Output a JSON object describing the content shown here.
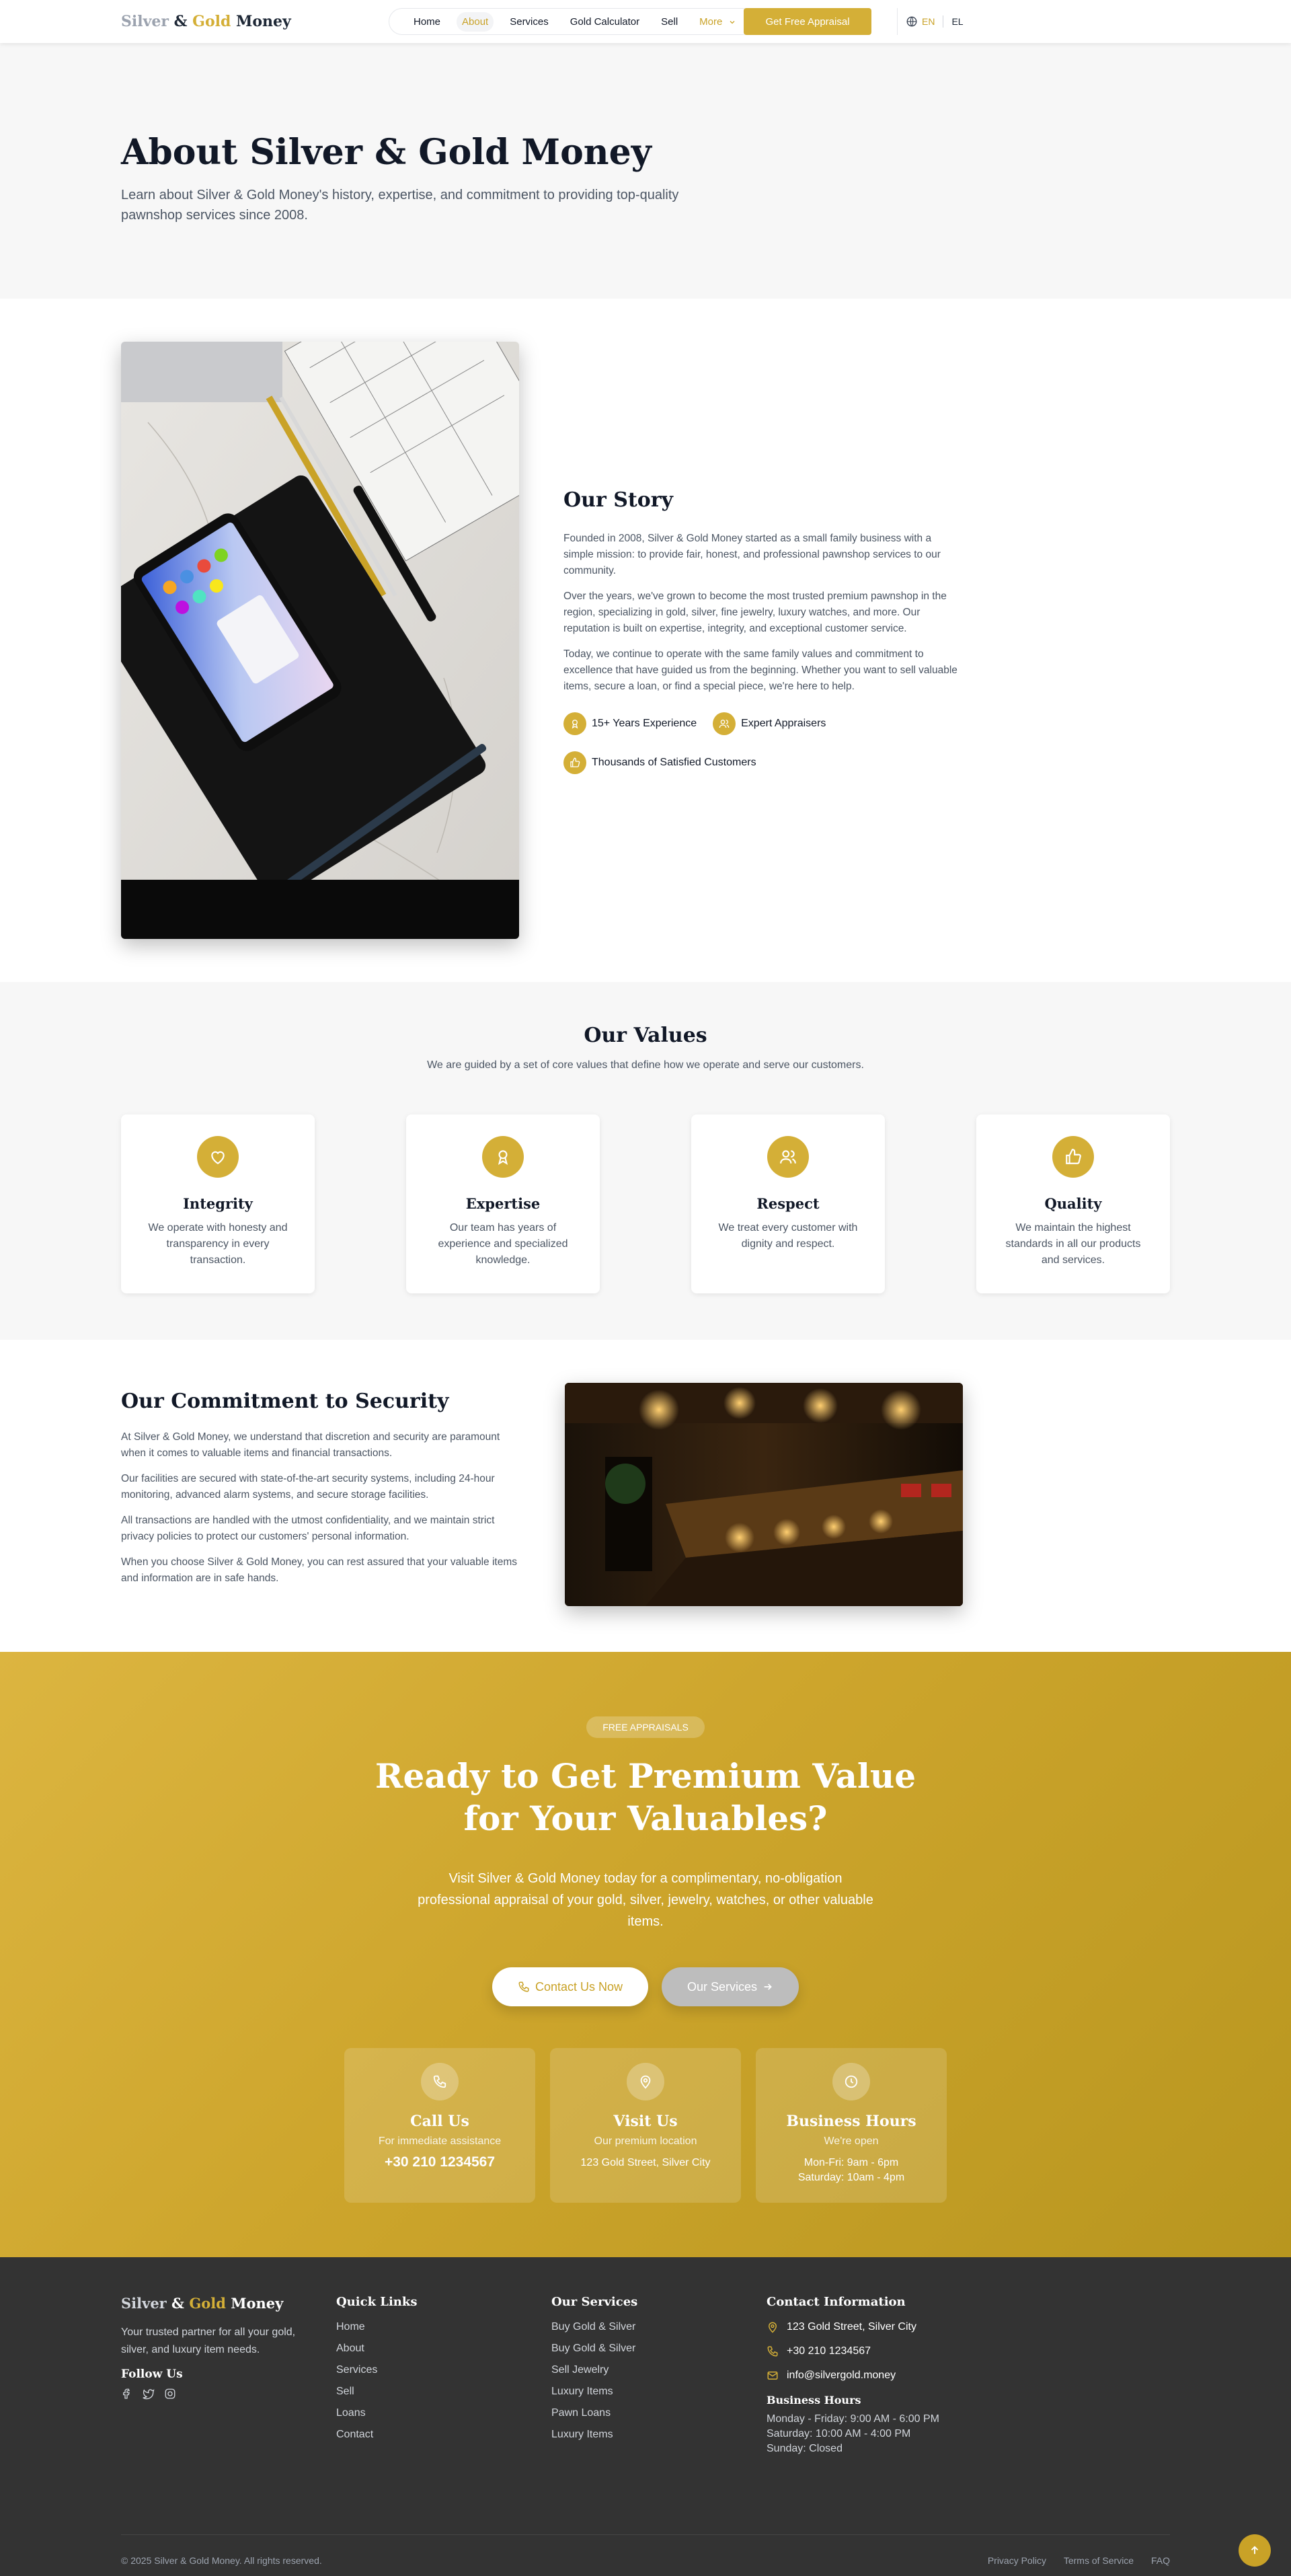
{
  "header": {
    "logo": {
      "part1": "Silver",
      "part2": " & ",
      "part3": "Gold",
      "part4": " Money"
    },
    "nav": [
      "Home",
      "About",
      "Services",
      "Gold Calculator",
      "Sell",
      "More"
    ],
    "cta": "Get Free Appraisal",
    "lang": {
      "current": "EN",
      "other": "EL"
    }
  },
  "hero": {
    "title": "About Silver & Gold Money",
    "subtitle": "Learn about Silver & Gold Money's history, expertise, and commitment to providing top-quality pawnshop services since 2008."
  },
  "story": {
    "title": "Our Story",
    "paragraphs": [
      "Founded in 2008, Silver & Gold Money started as a small family business with a simple mission: to provide fair, honest, and professional pawnshop services to our community.",
      "Over the years, we've grown to become the most trusted premium pawnshop in the region, specializing in gold, silver, fine jewelry, luxury watches, and more. Our reputation is built on expertise, integrity, and exceptional customer service.",
      "Today, we continue to operate with the same family values and commitment to excellence that have guided us from the beginning. Whether you want to sell valuable items, secure a loan, or find a special piece, we're here to help."
    ],
    "features": [
      "15+ Years Experience",
      "Expert Appraisers",
      "Thousands of Satisfied Customers"
    ]
  },
  "values": {
    "title": "Our Values",
    "subtitle": "We are guided by a set of core values that define how we operate and serve our customers.",
    "cards": [
      {
        "title": "Integrity",
        "text": "We operate with honesty and transparency in every transaction.",
        "icon": "heart-icon"
      },
      {
        "title": "Expertise",
        "text": "Our team has years of experience and specialized knowledge.",
        "icon": "award-icon"
      },
      {
        "title": "Respect",
        "text": "We treat every customer with dignity and respect.",
        "icon": "users-icon"
      },
      {
        "title": "Quality",
        "text": "We maintain the highest standards in all our products and services.",
        "icon": "thumbs-up-icon"
      }
    ]
  },
  "security": {
    "title": "Our Commitment to Security",
    "paragraphs": [
      "At Silver & Gold Money, we understand that discretion and security are paramount when it comes to valuable items and financial transactions.",
      "Our facilities are secured with state-of-the-art security systems, including 24-hour monitoring, advanced alarm systems, and secure storage facilities.",
      "All transactions are handled with the utmost confidentiality, and we maintain strict privacy policies to protect our customers' personal information.",
      "When you choose Silver & Gold Money, you can rest assured that your valuable items and information are in safe hands."
    ]
  },
  "cta": {
    "badge": "FREE APPRAISALS",
    "title": "Ready to Get Premium Value for Your Valuables?",
    "lead": "Visit Silver & Gold Money today for a complimentary, no-obligation professional appraisal of your gold, silver, jewelry, watches, or other valuable items.",
    "contact_btn": "Contact Us Now",
    "services_btn": "Our Services",
    "cards": [
      {
        "title": "Call Us",
        "sub": "For immediate assistance",
        "value": "+30 210 1234567"
      },
      {
        "title": "Visit Us",
        "sub": "Our premium location",
        "value": "123 Gold Street, Silver City"
      },
      {
        "title": "Business Hours",
        "sub": "We're open",
        "line1": "Mon-Fri: 9am - 6pm",
        "line2": "Saturday: 10am - 4pm"
      }
    ]
  },
  "footer": {
    "logo": {
      "part1": "Silver",
      "part2": " & ",
      "part3": "Gold",
      "part4": " Money"
    },
    "tagline": "Your trusted partner for all your gold, silver, and luxury item needs.",
    "follow": "Follow Us",
    "quick_title": "Quick Links",
    "quick": [
      "Home",
      "About",
      "Services",
      "Sell",
      "Loans",
      "Contact"
    ],
    "services_title": "Our Services",
    "services": [
      "Buy Gold & Silver",
      "Buy Gold & Silver",
      "Sell Jewelry",
      "Luxury Items",
      "Pawn Loans",
      "Luxury Items"
    ],
    "contact_title": "Contact Information",
    "address": "123 Gold Street, Silver City",
    "phone": "+30 210 1234567",
    "email": "info@silvergold.money",
    "hours_title": "Business Hours",
    "hours": [
      "Monday - Friday: 9:00 AM - 6:00 PM",
      "Saturday: 10:00 AM - 4:00 PM",
      "Sunday: Closed"
    ],
    "copyright": "© 2025 Silver & Gold Money. All rights reserved.",
    "legal": [
      "Privacy Policy",
      "Terms of Service",
      "FAQ"
    ]
  },
  "colors": {
    "gold": "#d4af37",
    "dark": "#333333",
    "light_bg": "#f7f7f7"
  }
}
